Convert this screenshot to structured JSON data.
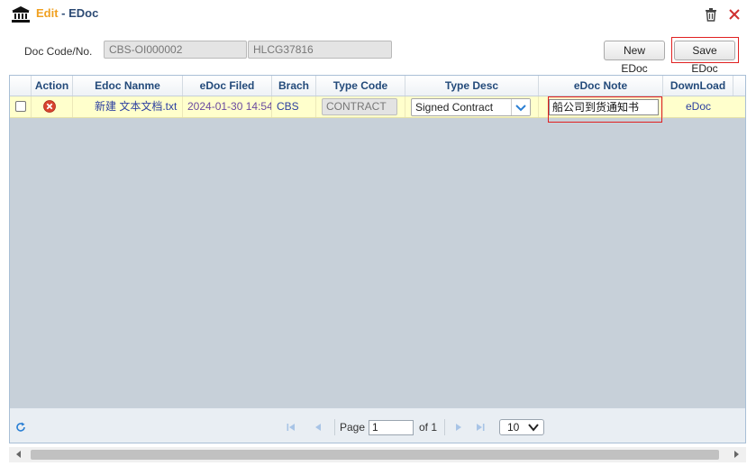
{
  "window": {
    "title_action": "Edit",
    "title_separator": " - ",
    "title_object": "EDoc",
    "title_icon": "bank-icon"
  },
  "form": {
    "doc_code_label": "Doc Code/No.",
    "doc_code_value": "CBS-OI000002",
    "doc_no_value": "HLCG37816",
    "new_edoc_label": "New EDoc",
    "save_edoc_label": "Save EDoc"
  },
  "grid": {
    "columns": [
      "Action",
      "Edoc Nanme",
      "eDoc Filed",
      "Brach",
      "Type Code",
      "Type Desc",
      "eDoc Note",
      "DownLoad"
    ],
    "rows": [
      {
        "action_icon": "delete-circle-icon",
        "edoc_name": "新建 文本文档.txt",
        "edoc_filed": "2024-01-30 14:54",
        "brach": "CBS",
        "type_code": "CONTRACT",
        "type_desc": "Signed Contract",
        "edoc_note": "船公司到货通知书",
        "download": "eDoc"
      }
    ]
  },
  "pager": {
    "page_label": "Page",
    "page_value": "1",
    "of_label": "of 1",
    "page_size": "10"
  },
  "colors": {
    "title_accent": "#f0a020",
    "header_text": "#234a7a",
    "row_highlight": "#ffffcc",
    "grid_empty": "#c7d0d9",
    "highlight_box": "#e02020"
  }
}
